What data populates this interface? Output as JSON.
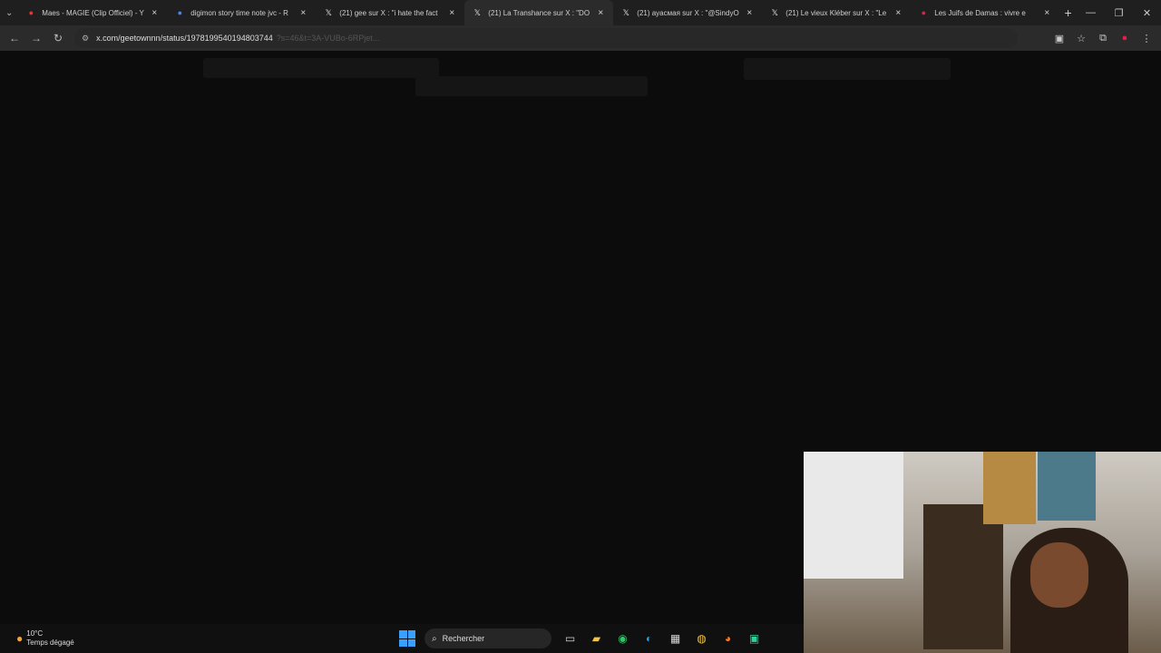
{
  "tabs": [
    {
      "title": "Maes - MAGIE (Clip Officiel) - Y",
      "favicon": "youtube-icon",
      "favicon_color": "#ff2a2a"
    },
    {
      "title": "digimon story time note jvc - R",
      "favicon": "google-icon",
      "favicon_color": "#4285f4"
    },
    {
      "title": "(21) gee sur X : \"i hate the fact",
      "favicon": "x-icon",
      "favicon_color": "#e6e6e6"
    },
    {
      "title": "(21) La Transhance sur X : \"DO",
      "favicon": "x-icon",
      "favicon_color": "#e6e6e6",
      "active": true
    },
    {
      "title": "(21) ayacмая sur X : \"@SindyO",
      "favicon": "x-icon",
      "favicon_color": "#e6e6e6"
    },
    {
      "title": "(21) Le vieux Kléber sur X : \"Le",
      "favicon": "x-icon",
      "favicon_color": "#e6e6e6"
    },
    {
      "title": "Les Juifs de Damas : vivre e",
      "favicon": "site-icon",
      "favicon_color": "#e11d48"
    }
  ],
  "close_glyph": "×",
  "new_tab_glyph": "+",
  "window_controls": {
    "minimize": "—",
    "restore": "❐",
    "close": "✕"
  },
  "nav": {
    "back": "←",
    "forward": "→",
    "reload": "↻"
  },
  "address": {
    "url": "x.com/geetownnn/status/1978199540194803744",
    "tail": "?s=46&t=3A-VUBo-6RPjet..."
  },
  "toolbar_right": {
    "install": "▣",
    "bookmark": "☆",
    "extensions": "⧉",
    "profile": "●",
    "menu": "⋮"
  },
  "weather": {
    "temp": "10°C",
    "condition": "Temps dégagé"
  },
  "taskbar": {
    "search_placeholder": "Rechercher"
  },
  "taskbar_apps": [
    {
      "name": "task-view-icon",
      "glyph": "▭",
      "color": "#cfcfcf"
    },
    {
      "name": "file-explorer-icon",
      "glyph": "▰",
      "color": "#f5c542"
    },
    {
      "name": "xbox-icon",
      "glyph": "◉",
      "color": "#31c46a"
    },
    {
      "name": "edge-icon",
      "glyph": "◐",
      "color": "#2d9cdb"
    },
    {
      "name": "store-icon",
      "glyph": "▦",
      "color": "#d9d9d9"
    },
    {
      "name": "chrome-icon",
      "glyph": "◍",
      "color": "#f2c744"
    },
    {
      "name": "firefox-icon",
      "glyph": "◕",
      "color": "#ff7a1a"
    },
    {
      "name": "app-icon",
      "glyph": "▣",
      "color": "#26d4a0"
    }
  ]
}
